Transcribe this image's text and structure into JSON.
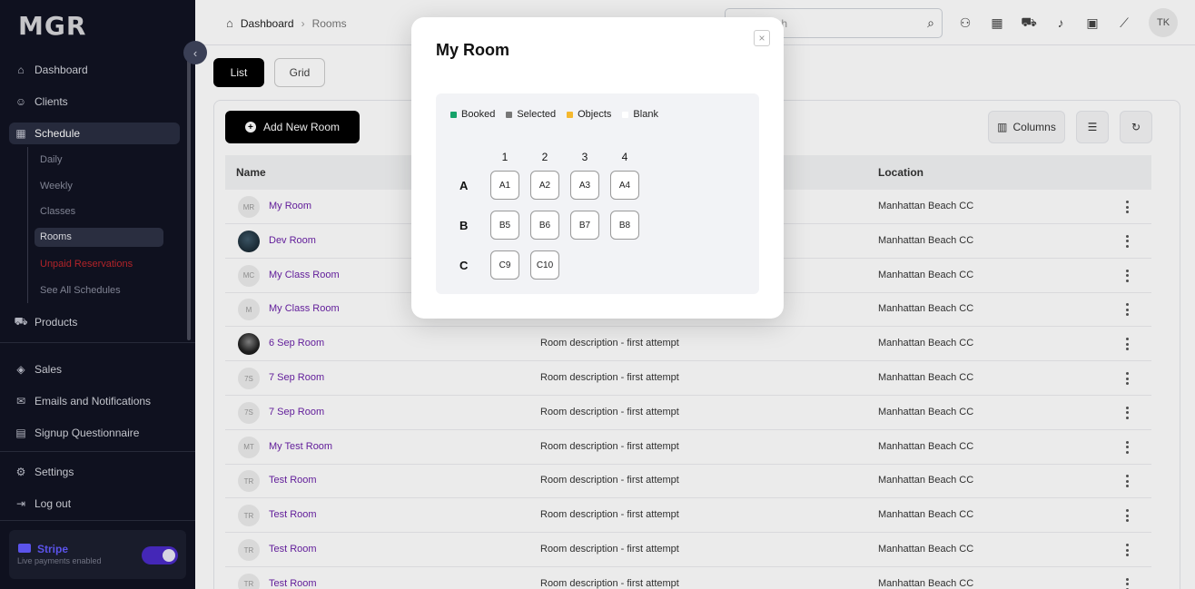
{
  "app": {
    "logo": "MGR"
  },
  "sidebar": {
    "items": [
      {
        "label": "Dashboard",
        "icon": "home-icon"
      },
      {
        "label": "Clients",
        "icon": "user-icon"
      },
      {
        "label": "Schedule",
        "icon": "calendar-icon"
      },
      {
        "label": "Products",
        "icon": "cart-icon"
      },
      {
        "label": "Sales",
        "icon": "box-icon"
      },
      {
        "label": "Emails and Notifications",
        "icon": "mail-icon"
      },
      {
        "label": "Signup Questionnaire",
        "icon": "document-icon"
      },
      {
        "label": "Settings",
        "icon": "gear-icon"
      },
      {
        "label": "Log out",
        "icon": "logout-icon"
      }
    ],
    "schedule_sub": [
      "Daily",
      "Weekly",
      "Classes",
      "Rooms",
      "Unpaid Reservations",
      "See All Schedules"
    ],
    "stripe": {
      "title": "Stripe",
      "subtitle": "Live payments enabled"
    }
  },
  "header": {
    "breadcrumb": [
      "Dashboard",
      "Rooms"
    ],
    "search_placeholder": "Search",
    "avatar_initials": "TK"
  },
  "tabs": [
    "List",
    "Grid"
  ],
  "toolbar": {
    "add_label": "Add New Room",
    "columns_label": "Columns"
  },
  "table": {
    "headers": [
      "Name",
      "Location"
    ],
    "rows": [
      {
        "initials": "MR",
        "name": "My Room",
        "desc": "",
        "loc": "Manhattan Beach CC"
      },
      {
        "initials": "",
        "name": "Dev Room",
        "desc": "",
        "loc": "Manhattan Beach CC"
      },
      {
        "initials": "MC",
        "name": "My Class Room",
        "desc": "",
        "loc": "Manhattan Beach CC"
      },
      {
        "initials": "M",
        "name": "My Class Room",
        "desc": "",
        "loc": "Manhattan Beach CC"
      },
      {
        "initials": "",
        "name": "6 Sep Room",
        "desc": "Room description - first attempt",
        "loc": "Manhattan Beach CC"
      },
      {
        "initials": "7S",
        "name": "7 Sep Room",
        "desc": "Room description - first attempt",
        "loc": "Manhattan Beach CC"
      },
      {
        "initials": "7S",
        "name": "7 Sep Room",
        "desc": "Room description - first attempt",
        "loc": "Manhattan Beach CC"
      },
      {
        "initials": "MT",
        "name": "My Test Room",
        "desc": "Room description - first attempt",
        "loc": "Manhattan Beach CC"
      },
      {
        "initials": "TR",
        "name": "Test Room",
        "desc": "Room description - first attempt",
        "loc": "Manhattan Beach CC"
      },
      {
        "initials": "TR",
        "name": "Test Room",
        "desc": "Room description - first attempt",
        "loc": "Manhattan Beach CC"
      },
      {
        "initials": "TR",
        "name": "Test Room",
        "desc": "Room description - first attempt",
        "loc": "Manhattan Beach CC"
      },
      {
        "initials": "TR",
        "name": "Test Room",
        "desc": "Room description - first attempt",
        "loc": "Manhattan Beach CC"
      }
    ]
  },
  "modal": {
    "title": "My Room",
    "close_glyph": "×",
    "legend": [
      {
        "label": "Booked",
        "color": "#16a36a"
      },
      {
        "label": "Selected",
        "color": "#777777"
      },
      {
        "label": "Objects",
        "color": "#f5b82e"
      },
      {
        "label": "Blank",
        "color": "#ffffff"
      }
    ],
    "columns": [
      "1",
      "2",
      "3",
      "4"
    ],
    "rows": [
      {
        "label": "A",
        "seats": [
          "A1",
          "A2",
          "A3",
          "A4"
        ]
      },
      {
        "label": "B",
        "seats": [
          "B5",
          "B6",
          "B7",
          "B8"
        ]
      },
      {
        "label": "C",
        "seats": [
          "C9",
          "C10"
        ]
      }
    ]
  }
}
